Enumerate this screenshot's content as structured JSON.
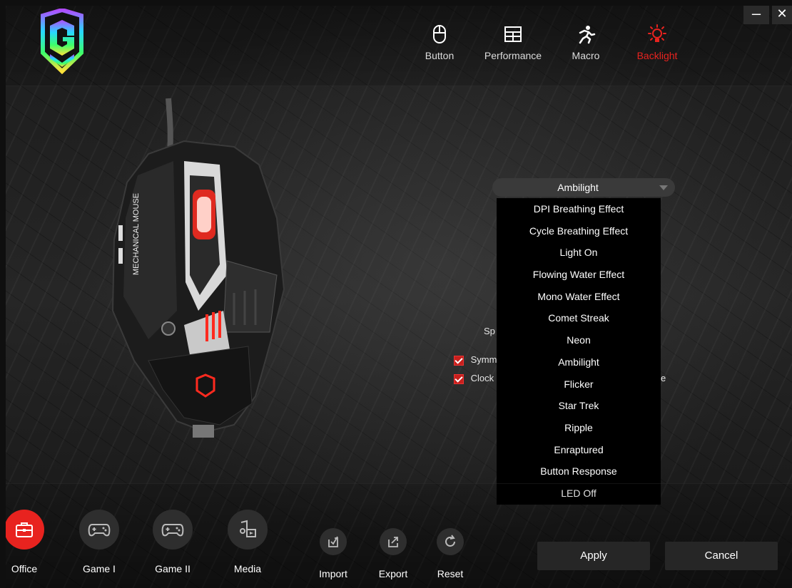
{
  "window": {
    "minimize_label": "–",
    "close_label": "✕"
  },
  "nav": [
    {
      "label": "Button",
      "icon": "mouse-icon"
    },
    {
      "label": "Performance",
      "icon": "grid-icon"
    },
    {
      "label": "Macro",
      "icon": "runner-icon"
    },
    {
      "label": "Backlight",
      "icon": "lightbulb-icon",
      "active": true
    }
  ],
  "mouse_text": "MECHANICAL MOUSE",
  "backlight": {
    "effect_selected": "Ambilight",
    "effect_options": [
      "DPI Breathing Effect",
      "Cycle Breathing Effect",
      "Light On",
      "Flowing Water Effect",
      "Mono Water Effect",
      "Comet Streak",
      "Neon",
      "Ambilight",
      "Flicker",
      "Star Trek",
      "Ripple",
      "Enraptured",
      "Button Response",
      "LED Off"
    ],
    "speed_label_partial": "Sp",
    "symmetric_label_partial": "Symm",
    "clockwise_label_partial": "Clock",
    "trailing_partial": "e"
  },
  "profiles": [
    {
      "label": "Office",
      "icon": "briefcase-icon",
      "active": true
    },
    {
      "label": "Game I",
      "icon": "gamepad-icon"
    },
    {
      "label": "Game II",
      "icon": "gamepad-icon"
    },
    {
      "label": "Media",
      "icon": "media-icon"
    }
  ],
  "tools": [
    {
      "label": "Import",
      "icon": "import-icon"
    },
    {
      "label": "Export",
      "icon": "export-icon"
    },
    {
      "label": "Reset",
      "icon": "reset-icon"
    }
  ],
  "actions": {
    "apply": "Apply",
    "cancel": "Cancel"
  },
  "colors": {
    "accent": "#e8231f"
  }
}
